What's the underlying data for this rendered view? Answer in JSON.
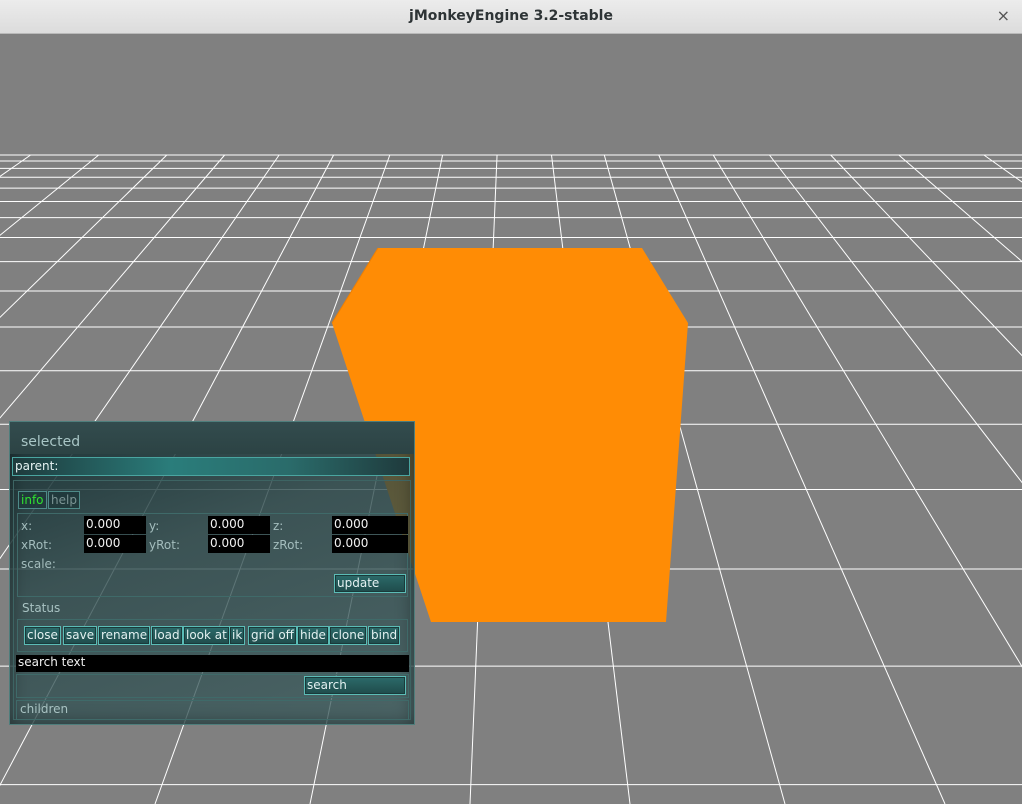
{
  "window": {
    "title": "jMonkeyEngine 3.2-stable",
    "close_symbol": "×"
  },
  "scene": {
    "cube_color": "#ff8c05",
    "grid_color": "#ffffff",
    "background_color": "#808080"
  },
  "panel": {
    "title": "selected",
    "parent_label": "parent:",
    "tabs": [
      {
        "label": "info",
        "active": true
      },
      {
        "label": "help",
        "active": false
      }
    ],
    "fields": {
      "x_label": "x:",
      "x_value": "0.000",
      "y_label": "y:",
      "y_value": "0.000",
      "z_label": "z:",
      "z_value": "0.000",
      "xrot_label": "xRot:",
      "xrot_value": "0.000",
      "yrot_label": "yRot:",
      "yrot_value": "0.000",
      "zrot_label": "zRot:",
      "zrot_value": "0.000",
      "scale_label": "scale:"
    },
    "update_label": "update",
    "status_label": "Status",
    "actions": [
      "close",
      "save",
      "rename",
      "load",
      "look at",
      "ik",
      "grid off",
      "hide",
      "clone",
      "bind"
    ],
    "search_value": "search text",
    "search_button": "search",
    "children_label": "children"
  }
}
